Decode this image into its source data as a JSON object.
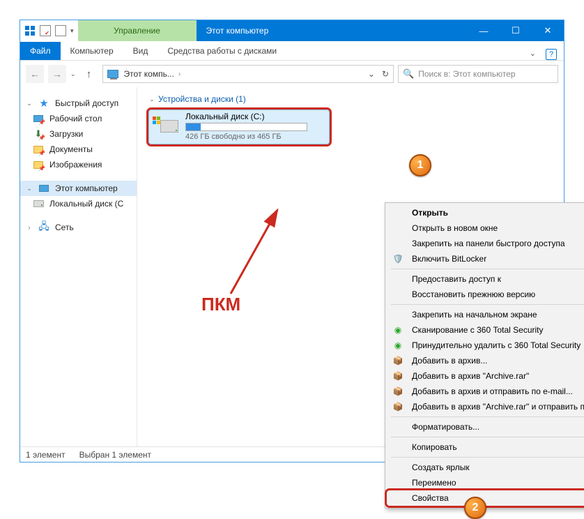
{
  "titlebar": {
    "manage": "Управление",
    "title": "Этот компьютер"
  },
  "ribbon": {
    "file": "Файл",
    "computer": "Компьютер",
    "view": "Вид",
    "drive_tools": "Средства работы с дисками"
  },
  "nav": {
    "back_symbol": "←",
    "fwd_symbol": "→",
    "up_symbol": "↑",
    "refresh_symbol": "↻",
    "dropdown_symbol": "⌄"
  },
  "address": {
    "location": "Этот компь...",
    "search_placeholder": "Поиск в: Этот компьютер"
  },
  "sidebar": {
    "quick_access": "Быстрый доступ",
    "desktop": "Рабочий стол",
    "downloads": "Загрузки",
    "documents": "Документы",
    "pictures": "Изображения",
    "this_pc": "Этот компьютер",
    "local_disk": "Локальный диск (С",
    "network": "Сеть"
  },
  "content": {
    "section": "Устройства и диски (1)",
    "disk_name": "Локальный диск (C:)",
    "disk_free": "426 ГБ свободно из 465 ГБ"
  },
  "context_menu": {
    "open": "Открыть",
    "open_new": "Открыть в новом окне",
    "pin_qa": "Закрепить на панели быстрого доступа",
    "bitlocker": "Включить BitLocker",
    "share": "Предоставить доступ к",
    "restore": "Восстановить прежнюю версию",
    "pin_start": "Закрепить на начальном экране",
    "scan360": "Сканирование с 360 Total Security",
    "del360": "Принудительно удалить с 360 Total Security",
    "add_archive": "Добавить в архив...",
    "add_archive_rar": "Добавить в архив \"Archive.rar\"",
    "add_email": "Добавить в архив и отправить по e-mail...",
    "add_rar_email": "Добавить в архив \"Archive.rar\" и отправить по e-mail",
    "format": "Форматировать...",
    "copy": "Копировать",
    "shortcut": "Создать ярлык",
    "rename": "Переимено",
    "properties": "Свойства"
  },
  "annot": {
    "rmb": "ПКМ",
    "badge1": "1",
    "badge2": "2"
  },
  "status": {
    "count": "1 элемент",
    "selected": "Выбран 1 элемент"
  }
}
